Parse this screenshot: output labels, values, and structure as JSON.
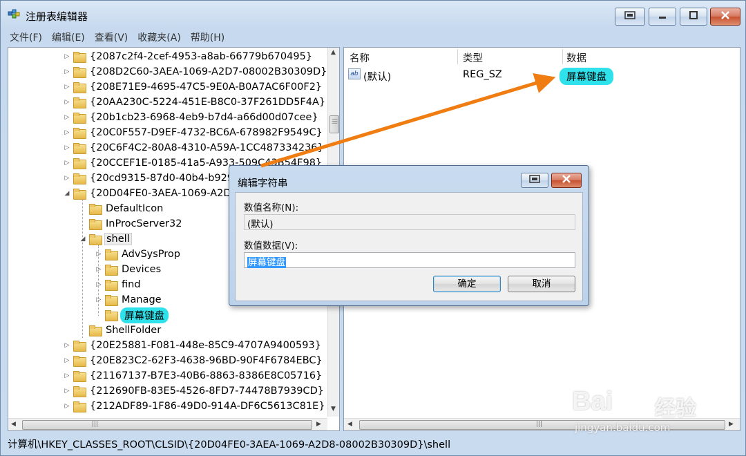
{
  "window": {
    "title": "注册表编辑器",
    "caption_buttons": [
      "restore-small-icon",
      "minimize-icon",
      "maximize-icon",
      "close-icon"
    ]
  },
  "menu": [
    "文件(F)",
    "编辑(E)",
    "查看(V)",
    "收藏夹(A)",
    "帮助(H)"
  ],
  "tree": {
    "items": [
      {
        "label": "{2087c2f4-2cef-4953-a8ab-66779b670495}",
        "level": 0,
        "expander": "▷"
      },
      {
        "label": "{208D2C60-3AEA-1069-A2D7-08002B30309D}",
        "level": 0,
        "expander": "▷"
      },
      {
        "label": "{208E71E9-4695-47C5-9E0A-B0A7AC6F00F2}",
        "level": 0,
        "expander": "▷"
      },
      {
        "label": "{20AA230C-5224-451E-B8C0-37F261DD5F4A}",
        "level": 0,
        "expander": "▷"
      },
      {
        "label": "{20b1cb23-6968-4eb9-b7d4-a66d00d07cee}",
        "level": 0,
        "expander": "▷"
      },
      {
        "label": "{20C0F557-D9EF-4732-BC6A-678982F9549C}",
        "level": 0,
        "expander": "▷"
      },
      {
        "label": "{20C6F4C2-80A8-4310-A59A-1CC487334236}",
        "level": 0,
        "expander": "▷"
      },
      {
        "label": "{20CCEF1E-0185-41a5-A933-509C43B54F98}",
        "level": 0,
        "expander": "▷"
      },
      {
        "label": "{20cd9315-87d0-40b4-b929",
        "level": 0,
        "expander": "▷"
      },
      {
        "label": "{20D04FE0-3AEA-1069-A2D",
        "level": 0,
        "expander": "◢"
      },
      {
        "label": "DefaultIcon",
        "level": 1,
        "expander": ""
      },
      {
        "label": "InProcServer32",
        "level": 1,
        "expander": ""
      },
      {
        "label": "shell",
        "level": 1,
        "expander": "◢",
        "selected": true
      },
      {
        "label": "AdvSysProp",
        "level": 2,
        "expander": "▷"
      },
      {
        "label": "Devices",
        "level": 2,
        "expander": "▷"
      },
      {
        "label": "find",
        "level": 2,
        "expander": "▷"
      },
      {
        "label": "Manage",
        "level": 2,
        "expander": "▷"
      },
      {
        "label": "屏幕键盘",
        "level": 2,
        "expander": "",
        "highlight": true
      },
      {
        "label": "ShellFolder",
        "level": 1,
        "expander": ""
      },
      {
        "label": "{20E25881-F081-448e-85C9-4707A9400593}",
        "level": 0,
        "expander": "▷"
      },
      {
        "label": "{20E823C2-62F3-4638-96BD-90F4F6784EBC}",
        "level": 0,
        "expander": "▷"
      },
      {
        "label": "{21167137-B7E3-40B6-8863-8386E8C05716}",
        "level": 0,
        "expander": "▷"
      },
      {
        "label": "{212690FB-83E5-4526-8FD7-74478B7939CD}",
        "level": 0,
        "expander": "▷"
      },
      {
        "label": "{212ADF89-1F86-49D0-914A-DF6C5613C81E}",
        "level": 0,
        "expander": "▷"
      }
    ],
    "scroll_up": "▲",
    "scroll_down": "▼",
    "scroll_left": "◀",
    "scroll_right": "▶",
    "scroll_grip": "|||"
  },
  "values": {
    "headers": {
      "name": "名称",
      "type": "类型",
      "data": "数据"
    },
    "rows": [
      {
        "icon": "ab",
        "name": "(默认)",
        "type": "REG_SZ",
        "data": "屏幕键盘"
      }
    ]
  },
  "status": {
    "path": "计算机\\HKEY_CLASSES_ROOT\\CLSID\\{20D04FE0-3AEA-1069-A2D8-08002B30309D}\\shell"
  },
  "dialog": {
    "title": "编辑字符串",
    "name_label": "数值名称(N):",
    "name_value": "(默认)",
    "data_label": "数值数据(V):",
    "data_value": "屏幕键盘",
    "ok_label": "确定",
    "cancel_label": "取消"
  },
  "watermark": {
    "brand": "Bai",
    "brand_cn": "经验",
    "url": "jingyan.baidu.com"
  },
  "colors": {
    "highlight": "#2ee1ea",
    "arrow": "#f07d12",
    "selection": "#3399ff"
  }
}
